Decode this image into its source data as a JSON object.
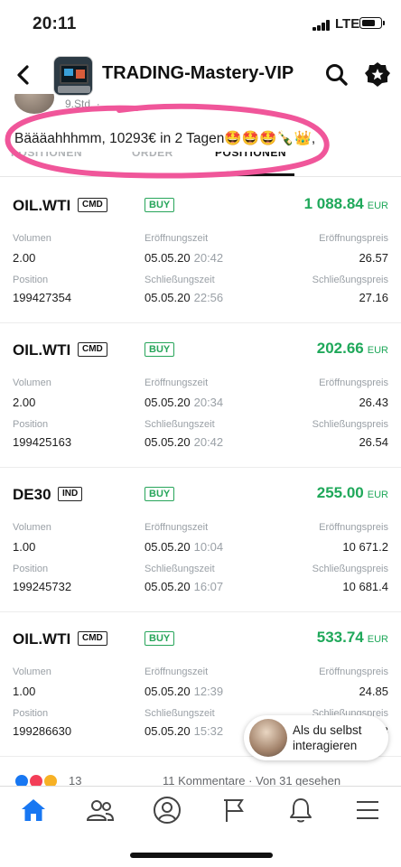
{
  "status": {
    "time": "20:11",
    "network": "LTE",
    "battery_level": 0.75
  },
  "header": {
    "title": "TRADING-Mastery-VIP"
  },
  "post": {
    "meta": "9.Std. · ",
    "text": "Bäääahhhmm, 10293€ in 2 Tagen🤩🤩🤩🍾👑,",
    "tabs": [
      "POSITIONEN",
      "ORDER",
      "POSITIONEN"
    ]
  },
  "positions": [
    {
      "symbol": "OIL.WTI",
      "type": "CMD",
      "side": "BUY",
      "profit": "1 088.84",
      "currency": "EUR",
      "labels": {
        "volume": "Volumen",
        "open_time": "Eröffnungszeit",
        "open_price": "Eröffnungspreis",
        "position": "Position",
        "close_time": "Schließungszeit",
        "close_price": "Schließungspreis"
      },
      "volume": "2.00",
      "open_date": "05.05.20",
      "open_time": "20:42",
      "open_price": "26.57",
      "position_id": "199427354",
      "close_date": "05.05.20",
      "close_time": "22:56",
      "close_price": "27.16"
    },
    {
      "symbol": "OIL.WTI",
      "type": "CMD",
      "side": "BUY",
      "profit": "202.66",
      "currency": "EUR",
      "labels": {
        "volume": "Volumen",
        "open_time": "Eröffnungszeit",
        "open_price": "Eröffnungspreis",
        "position": "Position",
        "close_time": "Schließungszeit",
        "close_price": "Schließungspreis"
      },
      "volume": "2.00",
      "open_date": "05.05.20",
      "open_time": "20:34",
      "open_price": "26.43",
      "position_id": "199425163",
      "close_date": "05.05.20",
      "close_time": "20:42",
      "close_price": "26.54"
    },
    {
      "symbol": "DE30",
      "type": "IND",
      "side": "BUY",
      "profit": "255.00",
      "currency": "EUR",
      "labels": {
        "volume": "Volumen",
        "open_time": "Eröffnungszeit",
        "open_price": "Eröffnungspreis",
        "position": "Position",
        "close_time": "Schließungszeit",
        "close_price": "Schließungspreis"
      },
      "volume": "1.00",
      "open_date": "05.05.20",
      "open_time": "10:04",
      "open_price": "10 671.2",
      "position_id": "199245732",
      "close_date": "05.05.20",
      "close_time": "16:07",
      "close_price": "10 681.4"
    },
    {
      "symbol": "OIL.WTI",
      "type": "CMD",
      "side": "BUY",
      "profit": "533.74",
      "currency": "EUR",
      "labels": {
        "volume": "Volumen",
        "open_time": "Eröffnungszeit",
        "open_price": "Eröffnungspreis",
        "position": "Position",
        "close_time": "Schließungszeit",
        "close_price": "Schließungspreis"
      },
      "volume": "1.00",
      "open_date": "05.05.20",
      "open_time": "12:39",
      "open_price": "24.85",
      "position_id": "199286630",
      "close_date": "05.05.20",
      "close_time": "15:32",
      "close_price": "3"
    }
  ],
  "bubble": {
    "text": "Als du selbst interagieren"
  },
  "footer": {
    "reaction_count": "13",
    "comments_info": "11 Kommentare · Von 31 gesehen"
  },
  "colors": {
    "profit": "#1fa85a",
    "buy": "#27a55a",
    "accent": "#1877f2",
    "highlight": "#f0569a"
  },
  "nav_icons": [
    "home-icon",
    "friends-icon",
    "profile-icon",
    "pages-flag-icon",
    "notifications-bell-icon",
    "menu-icon"
  ]
}
